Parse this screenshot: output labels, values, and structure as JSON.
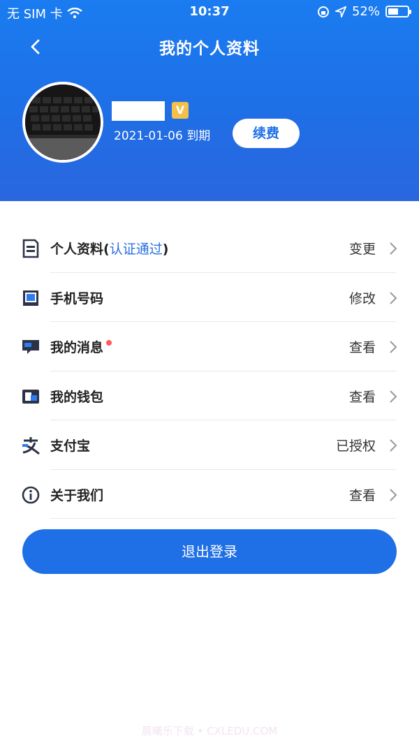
{
  "status": {
    "carrier": "无 SIM 卡",
    "time": "10:37",
    "battery": "52%"
  },
  "header": {
    "title": "我的个人资料",
    "expire": "2021-01-06 到期",
    "renew_label": "续费",
    "vip_label": "V"
  },
  "menu": [
    {
      "label": "个人资料(",
      "verified": "认证通过",
      "label_end": ")",
      "value": "变更",
      "icon": "profile-card-icon"
    },
    {
      "label": "手机号码",
      "value": "修改",
      "icon": "phone-icon"
    },
    {
      "label": "我的消息",
      "value": "查看",
      "icon": "message-icon",
      "unread": true
    },
    {
      "label": "我的钱包",
      "value": "查看",
      "icon": "wallet-icon"
    },
    {
      "label": "支付宝",
      "value": "已授权",
      "icon": "alipay-icon"
    },
    {
      "label": "关于我们",
      "value": "查看",
      "icon": "info-icon"
    }
  ],
  "logout_label": "退出登录",
  "watermark": "晨曦乐下载 • CXLEDU.COM",
  "colors": {
    "primary": "#1f6fe6",
    "accent": "#2a6fe0",
    "dot": "#ff5a5a"
  }
}
